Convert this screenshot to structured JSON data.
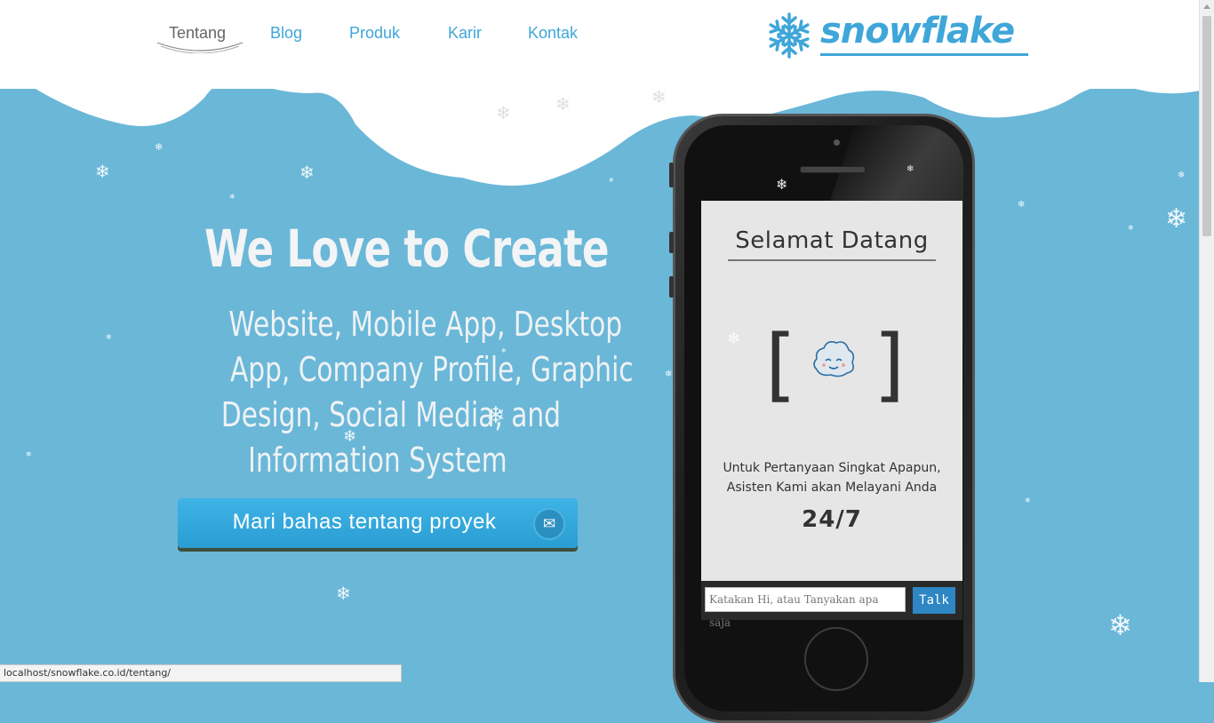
{
  "nav": {
    "items": [
      {
        "label": "Tentang",
        "active": true
      },
      {
        "label": "Blog",
        "active": false
      },
      {
        "label": "Produk",
        "active": false
      },
      {
        "label": "Karir",
        "active": false
      },
      {
        "label": "Kontak",
        "active": false
      }
    ]
  },
  "logo": {
    "text": "snowflake",
    "icon": "snowflake-icon"
  },
  "hero": {
    "title": "We Love to Create",
    "subtitle_lines": [
      "Website, Mobile App, Desktop",
      "App, Company Profile, Graphic",
      "Design, Social Media, and",
      "Information System"
    ],
    "cta_label": "Mari bahas tentang proyek",
    "cta_icon": "envelope-icon"
  },
  "phone": {
    "screen_title": "Selamat Datang",
    "bracket_left": "[",
    "bracket_right": "]",
    "message_lines": [
      "Untuk Pertanyaan Singkat Apapun,",
      "Asisten Kami akan Melayani Anda"
    ],
    "availability": "24/7",
    "chat_placeholder": "Katakan Hi, atau Tanyakan apa saja",
    "chat_button": "Talk"
  },
  "status_bar": {
    "url": "localhost/snowflake.co.id/tentang/"
  },
  "colors": {
    "background": "#6ab7d8",
    "accent": "#3fa6d9",
    "cta": "#2a9dd2"
  }
}
